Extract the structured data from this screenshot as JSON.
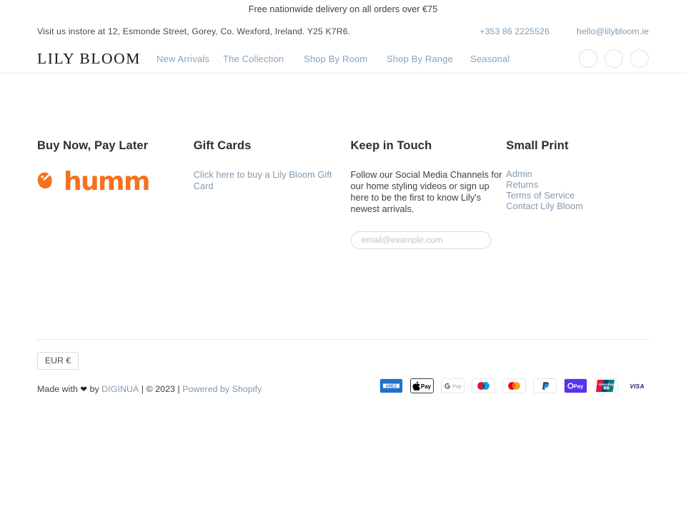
{
  "announcement": {
    "text": "Free nationwide delivery on all orders over €75"
  },
  "contact": {
    "address": "Visit us instore at 12, Esmonde Street, Gorey, Co. Wexford, Ireland. Y25 K7R6.",
    "phone": "+353 86 2225526",
    "email": "hello@lilybloom.ie"
  },
  "header": {
    "logo": "LILY BLOOM",
    "nav": [
      {
        "label": "New Arrivals"
      },
      {
        "label": "The Collection"
      },
      {
        "label": "Shop By Room"
      },
      {
        "label": "Shop By Range"
      },
      {
        "label": "Seasonal"
      }
    ],
    "icons": [
      {
        "name": "search-icon"
      },
      {
        "name": "account-icon"
      },
      {
        "name": "cart-icon"
      }
    ]
  },
  "footer": {
    "columns": [
      {
        "title": "Buy Now, Pay Later",
        "logo": {
          "name": "humm-logo",
          "text": "humm",
          "color": "#f4721e"
        }
      },
      {
        "title": "Gift Cards",
        "links": [
          {
            "label": "Click here to buy a Lily Bloom Gift Card"
          }
        ]
      },
      {
        "title": "Keep in Touch",
        "body": "Follow our Social Media Channels for our home styling videos or sign up here to be the first to know Lily's newest arrivals.",
        "newsletter": {
          "placeholder": "email@example.com",
          "value": ""
        }
      },
      {
        "title": "Small Print",
        "links": [
          {
            "label": "Admin"
          },
          {
            "label": "Returns"
          },
          {
            "label": "Terms of Service"
          },
          {
            "label": "Contact Lily Bloom"
          }
        ]
      }
    ],
    "bottom": {
      "currency": "EUR €",
      "credit_prefix": "Made with ",
      "credit_heart": "❤",
      "credit_by": " by ",
      "credit_agency": "DIGINUA",
      "credit_sep1": " | ",
      "credit_copyright": "© 2023",
      "credit_sep2": " | ",
      "credit_shopify": "Powered by Shopify",
      "payments": [
        {
          "name": "amex-icon",
          "label": "AMEX"
        },
        {
          "name": "apple-pay-icon",
          "label": "Apple Pay"
        },
        {
          "name": "google-pay-icon",
          "label": "G Pay"
        },
        {
          "name": "maestro-icon",
          "label": "Maestro"
        },
        {
          "name": "mastercard-icon",
          "label": "Mastercard"
        },
        {
          "name": "paypal-icon",
          "label": "PayPal"
        },
        {
          "name": "shop-pay-icon",
          "label": "Shop Pay"
        },
        {
          "name": "unionpay-icon",
          "label": "UnionPay"
        },
        {
          "name": "visa-icon",
          "label": "VISA"
        }
      ]
    }
  },
  "colors": {
    "link": "#7f9bb3",
    "nav_link": "#8aa4ba",
    "humm_orange": "#f4721e",
    "text": "#3f3f3f",
    "border": "#e4e6e8"
  }
}
